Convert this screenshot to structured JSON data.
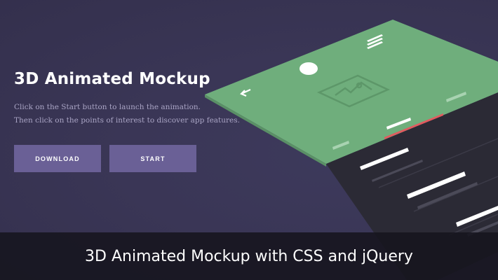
{
  "hero": {
    "title": "3D Animated Mockup",
    "desc_line1": "Click on the Start button to launch the animation.",
    "desc_line2": "Then click on the points of interest to discover app features."
  },
  "buttons": {
    "download": "DOWNLOAD",
    "start": "START"
  },
  "mockup": {
    "header_color": "#6fae7c",
    "body_color": "#2b2a35",
    "accent_color": "#e25a5f",
    "icons": [
      "hamburger-menu-icon",
      "circle-avatar",
      "image-placeholder-icon",
      "back-arrow-icon"
    ]
  },
  "caption": {
    "text": "3D Animated Mockup with CSS and jQuery"
  },
  "colors": {
    "background": "#3a3656",
    "button": "#6a6096"
  }
}
